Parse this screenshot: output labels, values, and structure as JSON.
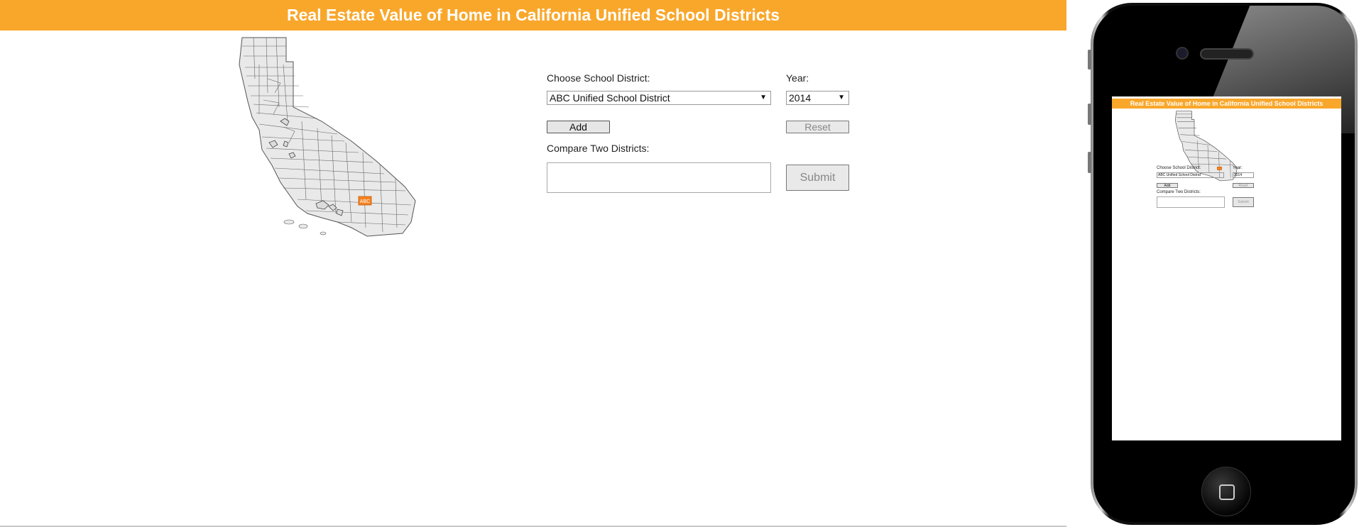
{
  "app": {
    "title": "Real Estate Value of Home in California Unified School Districts"
  },
  "colors": {
    "accent": "#f9a72b",
    "map_fill": "#e9e9e9",
    "map_stroke": "#555555",
    "marker": "#f58220"
  },
  "map": {
    "marker_label": "ABC"
  },
  "form": {
    "district_label": "Choose School District:",
    "district_value": "ABC Unified School District",
    "year_label": "Year:",
    "year_value": "2014",
    "add_label": "Add",
    "reset_label": "Reset",
    "compare_label": "Compare Two Districts:",
    "compare_value": "",
    "submit_label": "Submit"
  },
  "icons": {
    "caret": "▼",
    "home": "square-home-icon"
  }
}
